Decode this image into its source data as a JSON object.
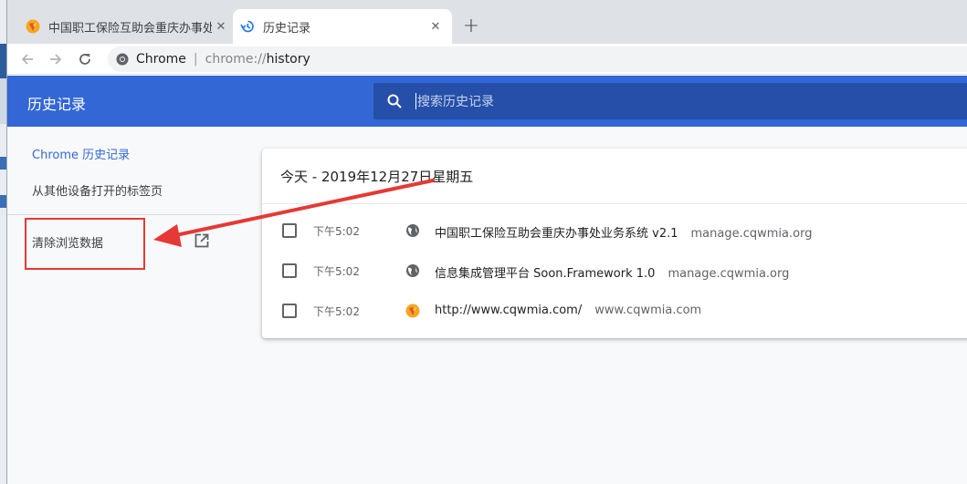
{
  "tabs": [
    {
      "title": "中国职工保险互助会重庆办事处",
      "active": false,
      "close": "✕"
    },
    {
      "title": "历史记录",
      "active": true,
      "close": "✕"
    }
  ],
  "toolbar": {
    "new_tab": "+",
    "omnibox": {
      "origin_label": "Chrome",
      "separator": "|",
      "scheme": "chrome://",
      "path": "history"
    }
  },
  "history_page": {
    "title": "历史记录",
    "search_placeholder": "搜索历史记录",
    "sidebar": {
      "items": [
        "Chrome 历史记录",
        "从其他设备打开的标签页",
        "清除浏览数据"
      ],
      "active_index": 0
    },
    "date_heading": "今天 - 2019年12月27日星期五",
    "entries": [
      {
        "time": "下午5:02",
        "icon": "globe-icon",
        "title": "中国职工保险互助会重庆办事处业务系统 v2.1",
        "domain": "manage.cqwmia.org"
      },
      {
        "time": "下午5:02",
        "icon": "globe-icon",
        "title": "信息集成管理平台 Soon.Framework 1.0",
        "domain": "manage.cqwmia.org"
      },
      {
        "time": "下午5:02",
        "icon": "site-favicon-icon",
        "title": "http://www.cqwmia.com/",
        "domain": "www.cqwmia.com"
      }
    ]
  },
  "colors": {
    "header_blue": "#3367d6",
    "search_blue": "#254fa8",
    "annotation_red": "#e53935"
  }
}
